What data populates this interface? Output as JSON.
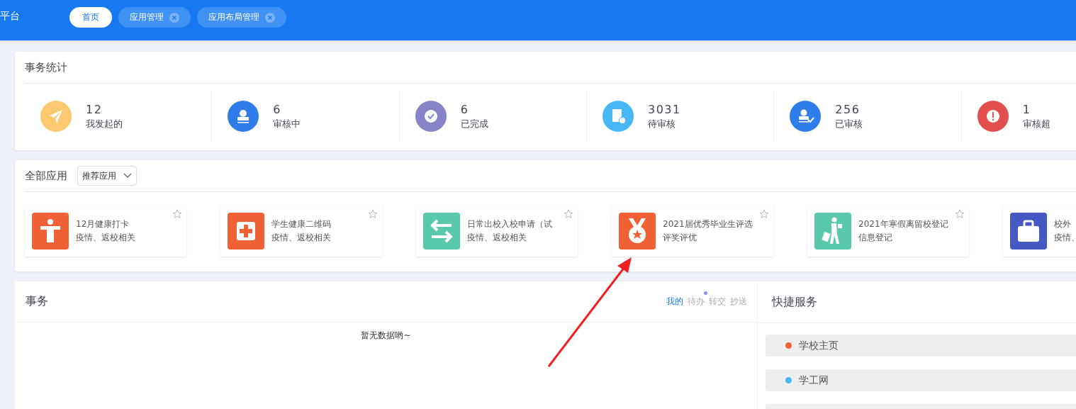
{
  "top_bar": {
    "title": "平台",
    "tabs": [
      {
        "label": "首页",
        "selected": true,
        "closable": false
      },
      {
        "label": "应用管理",
        "selected": false,
        "closable": true
      },
      {
        "label": "应用布局管理",
        "selected": false,
        "closable": true
      }
    ]
  },
  "stats": {
    "title": "事务统计",
    "items": [
      {
        "kind": "send",
        "value": "12",
        "label": "我发起的",
        "color": "#fdc96e"
      },
      {
        "kind": "stamp",
        "value": "6",
        "label": "审核中",
        "color": "#2f7de8"
      },
      {
        "kind": "check",
        "value": "6",
        "label": "已完成",
        "color": "#8785c8"
      },
      {
        "kind": "doc",
        "value": "3031",
        "label": "待审核",
        "color": "#47b8f5"
      },
      {
        "kind": "approved",
        "value": "256",
        "label": "已审核",
        "color": "#2f7de8"
      },
      {
        "kind": "alert",
        "value": "1",
        "label": "审核超",
        "color": "#e34f4f"
      }
    ]
  },
  "apps": {
    "title": "全部应用",
    "filter": "推荐应用",
    "items": [
      {
        "kind": "person",
        "title": "12月健康打卡",
        "subtitle": "疫情、返校相关",
        "color": "#f06235"
      },
      {
        "kind": "medical",
        "title": "学生健康二维码",
        "subtitle": "疫情、返校相关",
        "color": "#f06235"
      },
      {
        "kind": "swap",
        "title": "日常出校入校申请（试",
        "subtitle": "疫情、返校相关",
        "color": "#5ac9ab"
      },
      {
        "kind": "medal",
        "title": "2021届优秀毕业生评选",
        "subtitle": "评奖评优",
        "color": "#f06235"
      },
      {
        "kind": "traveler",
        "title": "2021年寒假离留校登记",
        "subtitle": "信息登记",
        "color": "#5ac9ab"
      },
      {
        "kind": "briefcase",
        "title": "校外",
        "subtitle": "疫情、",
        "color": "#4658c4"
      }
    ]
  },
  "affairs": {
    "title": "事务",
    "tabs": [
      {
        "label": "我的",
        "selected": true,
        "badge": false
      },
      {
        "label": "待办",
        "selected": false,
        "badge": true
      },
      {
        "label": "转交",
        "selected": false,
        "badge": false
      },
      {
        "label": "抄送",
        "selected": false,
        "badge": false
      }
    ],
    "empty_text": "暂无数据哟~"
  },
  "quick_services": {
    "title": "快捷服务",
    "items": [
      {
        "kind": "link",
        "label": "学校主页",
        "color": "#f06235"
      },
      {
        "kind": "link",
        "label": "学工网",
        "color": "#47b8f5"
      },
      {
        "kind": "placeholder"
      }
    ]
  }
}
